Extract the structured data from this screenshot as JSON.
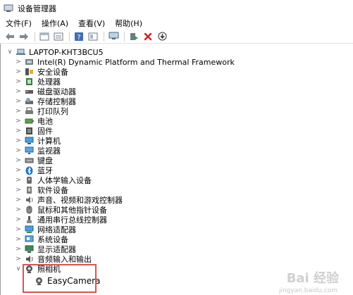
{
  "window": {
    "title": "设备管理器"
  },
  "menu": [
    {
      "label": "文件(F)"
    },
    {
      "label": "操作(A)"
    },
    {
      "label": "查看(V)"
    },
    {
      "label": "帮助(H)"
    }
  ],
  "toolbar": {
    "icons": [
      "back-arrow-icon",
      "forward-arrow-icon",
      "properties-icon",
      "show-hide-icon",
      "help-icon",
      "view-icon",
      "scan-monitor-icon",
      "update-driver-icon",
      "uninstall-icon",
      "disable-icon"
    ]
  },
  "tree": {
    "root": "LAPTOP-KHT3BCU5",
    "items": [
      {
        "label": "Intel(R) Dynamic Platform and Thermal Framework",
        "icon": "thermal-framework-icon"
      },
      {
        "label": "安全设备",
        "icon": "security-device-icon"
      },
      {
        "label": "处理器",
        "icon": "processor-icon"
      },
      {
        "label": "磁盘驱动器",
        "icon": "disk-drive-icon"
      },
      {
        "label": "存储控制器",
        "icon": "storage-controller-icon"
      },
      {
        "label": "打印队列",
        "icon": "print-queue-icon"
      },
      {
        "label": "电池",
        "icon": "battery-icon"
      },
      {
        "label": "固件",
        "icon": "firmware-icon"
      },
      {
        "label": "计算机",
        "icon": "computer-icon"
      },
      {
        "label": "监视器",
        "icon": "monitor-icon"
      },
      {
        "label": "键盘",
        "icon": "keyboard-icon"
      },
      {
        "label": "蓝牙",
        "icon": "bluetooth-icon"
      },
      {
        "label": "人体学输入设备",
        "icon": "hid-icon"
      },
      {
        "label": "软件设备",
        "icon": "software-device-icon"
      },
      {
        "label": "声音、视频和游戏控制器",
        "icon": "sound-video-icon"
      },
      {
        "label": "鼠标和其他指针设备",
        "icon": "mouse-icon"
      },
      {
        "label": "通用串行总线控制器",
        "icon": "usb-icon"
      },
      {
        "label": "网络适配器",
        "icon": "network-adapter-icon"
      },
      {
        "label": "系统设备",
        "icon": "system-device-icon"
      },
      {
        "label": "显示适配器",
        "icon": "display-adapter-icon"
      },
      {
        "label": "音频输入和输出",
        "icon": "audio-io-icon"
      },
      {
        "label": "照相机",
        "icon": "camera-icon",
        "expanded": true
      }
    ],
    "camera_child": {
      "label": "EasyCamera",
      "icon": "webcam-icon"
    }
  },
  "watermark": {
    "main": "Bai 经验",
    "sub": "jingyan.baidu.com"
  },
  "colors": {
    "highlight": "#d9534f"
  }
}
